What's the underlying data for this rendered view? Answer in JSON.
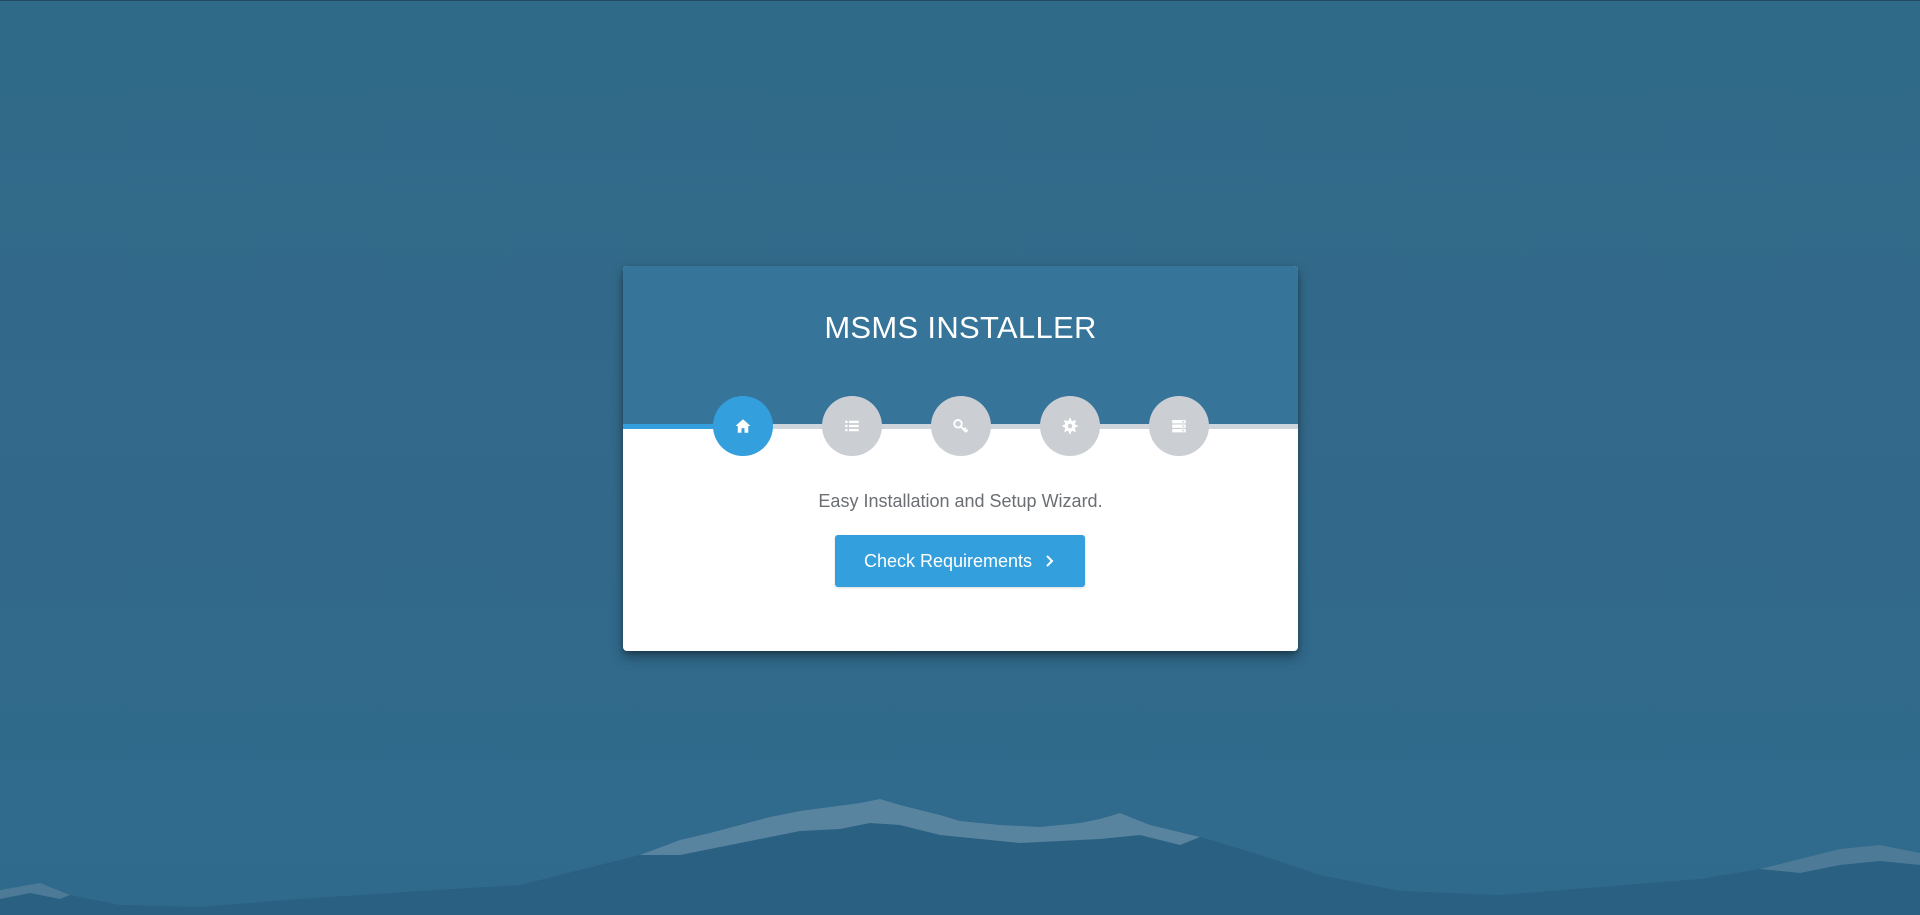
{
  "installer": {
    "title": "MSMS INSTALLER",
    "subtitle": "Easy Installation and Setup Wizard.",
    "button_label": "Check Requirements",
    "progress_percent": 14,
    "steps": [
      {
        "icon": "home-icon",
        "state": "active"
      },
      {
        "icon": "list-icon",
        "state": "inactive"
      },
      {
        "icon": "key-icon",
        "state": "inactive"
      },
      {
        "icon": "gear-icon",
        "state": "inactive"
      },
      {
        "icon": "server-icon",
        "state": "inactive"
      }
    ]
  },
  "colors": {
    "background": "#33698a",
    "header": "#367499",
    "accent": "#349fdd",
    "step_inactive": "#cbcfd3",
    "subtitle_text": "#6b6f73"
  }
}
